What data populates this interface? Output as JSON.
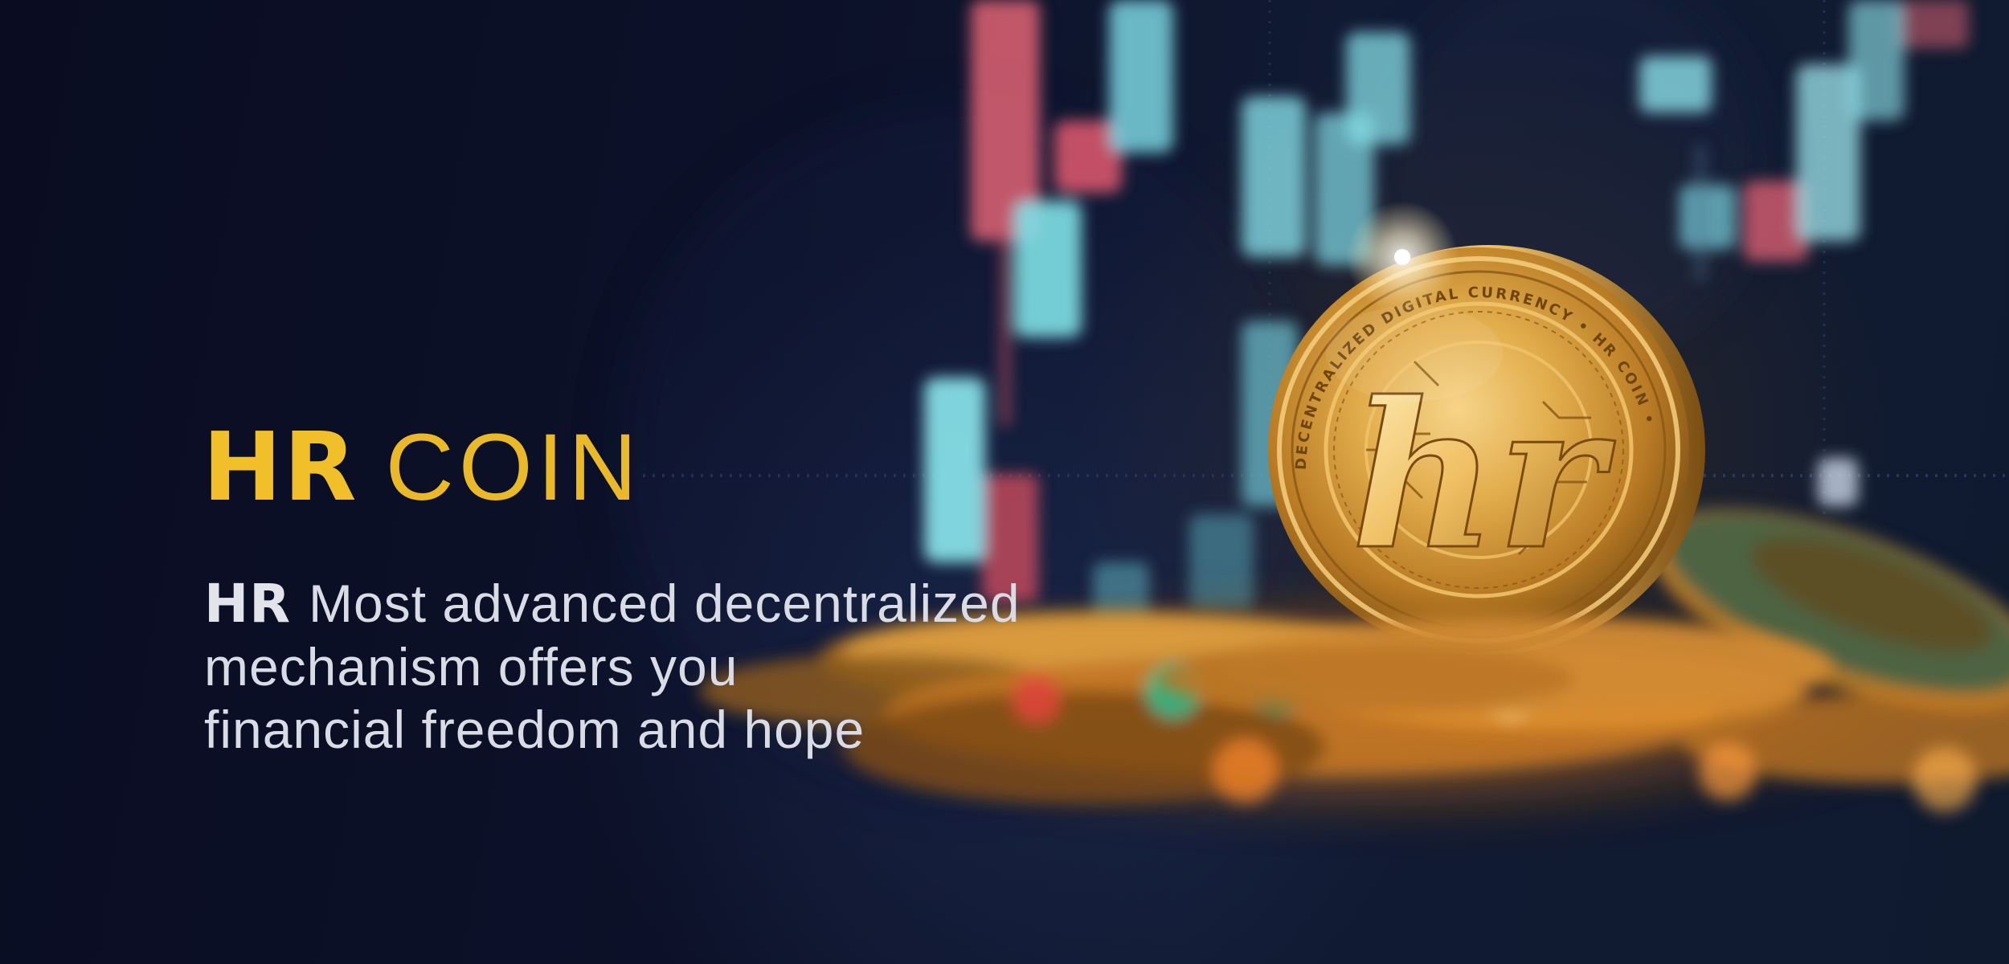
{
  "hero": {
    "title_brand": "HR",
    "title_word": "COIN",
    "tagline_brand": "HR",
    "tagline_line1": "Most advanced decentralized",
    "tagline_line2": "mechanism offers you",
    "tagline_line3": "financial freedom and hope"
  },
  "coin": {
    "emblem_letters": "hr",
    "ring_text": "DECENTRALIZED DIGITAL CURRENCY • HR COIN •",
    "color": "#d9a437"
  },
  "colors": {
    "accent": "#f0bf2a",
    "background": "#0b0f26",
    "text": "#d8dbe3"
  }
}
